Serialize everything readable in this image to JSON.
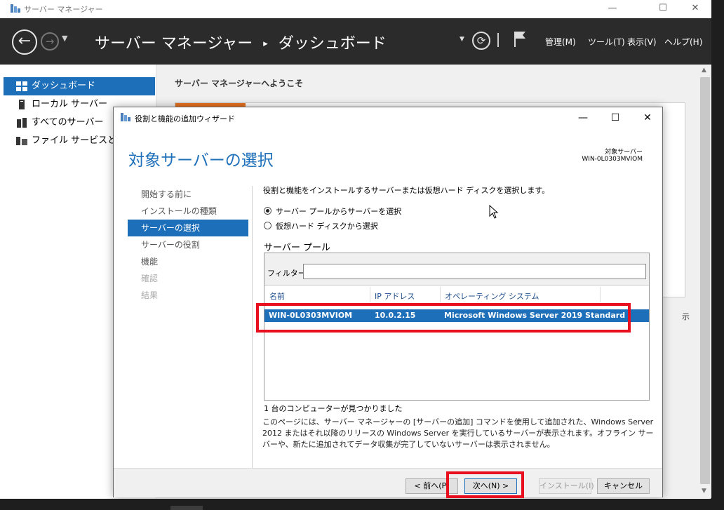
{
  "window": {
    "title": "サーバー マネージャー",
    "min_icon": "minimize-icon",
    "max_icon": "maximize-icon",
    "close_icon": "close-icon"
  },
  "header": {
    "breadcrumb_root": "サーバー マネージャー",
    "breadcrumb_sep": "▸",
    "breadcrumb_current": "ダッシュボード",
    "menu": [
      "管理(M)",
      "ツール(T)",
      "表示(V)",
      "ヘルプ(H)"
    ]
  },
  "sidebar": {
    "items": [
      {
        "label": "ダッシュボード",
        "icon": "dashboard-icon",
        "active": true
      },
      {
        "label": "ローカル サーバー",
        "icon": "server-icon",
        "active": false
      },
      {
        "label": "すべてのサーバー",
        "icon": "servers-icon",
        "active": false
      },
      {
        "label": "ファイル サービスと記憶域サービス",
        "icon": "file-services-icon",
        "active": false
      }
    ]
  },
  "main": {
    "welcome": "サーバー マネージャーへようこそ",
    "bg_fragment": "示"
  },
  "wizard": {
    "title": "役割と機能の追加ウィザード",
    "heading": "対象サーバーの選択",
    "target_label": "対象サーバー",
    "target_value": "WIN-0L0303MVIOM",
    "steps": [
      {
        "label": "開始する前に",
        "state": "normal"
      },
      {
        "label": "インストールの種類",
        "state": "normal"
      },
      {
        "label": "サーバーの選択",
        "state": "active"
      },
      {
        "label": "サーバーの役割",
        "state": "normal"
      },
      {
        "label": "機能",
        "state": "normal"
      },
      {
        "label": "確認",
        "state": "disabled"
      },
      {
        "label": "結果",
        "state": "disabled"
      }
    ],
    "description": "役割と機能をインストールするサーバーまたは仮想ハード ディスクを選択します。",
    "radio_pool": "サーバー プールからサーバーを選択",
    "radio_vhd": "仮想ハード ディスクから選択",
    "pool_label": "サーバー プール",
    "filter_label": "フィルター:",
    "filter_value": "",
    "columns": [
      "名前",
      "IP アドレス",
      "オペレーティング システム"
    ],
    "rows": [
      {
        "name": "WIN-0L0303MVIOM",
        "ip": "10.0.2.15",
        "os": "Microsoft Windows Server 2019 Standard"
      }
    ],
    "found": "1 台のコンピューターが見つかりました",
    "info": "このページには、サーバー マネージャーの [サーバーの追加] コマンドを使用して追加された、Windows Server 2012 またはそれ以降のリリースの Windows Server を実行しているサーバーが表示されます。オフライン サーバーや、新たに追加されてデータ収集が完了していないサーバーは表示されません。",
    "buttons": {
      "prev": "< 前へ(P)",
      "next": "次へ(N) >",
      "install": "インストール(I)",
      "cancel": "キャンセル"
    }
  },
  "colors": {
    "accent": "#1e6fb9",
    "header_bg": "#2b2b2b",
    "highlight": "#e8101e",
    "tile_accent": "#e8711f"
  }
}
